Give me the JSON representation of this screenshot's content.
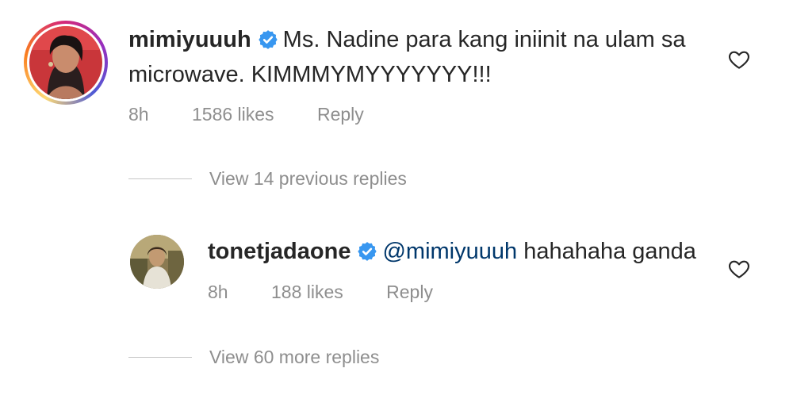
{
  "comment": {
    "username": "mimiyuuuh",
    "text_line1": "Ms. Nadine para kang iniinit na ulam sa",
    "text_line2": "microwave. KIMMMYMYYYYYYY!!!",
    "time": "8h",
    "likes": "1586 likes",
    "reply_label": "Reply",
    "avatar_icon": "profile-photo-woman",
    "like_icon": "heart-outline-icon"
  },
  "previous_replies": {
    "label": "View 14 previous replies"
  },
  "reply": {
    "username": "tonetjadaone",
    "mention": "@mimiyuuuh",
    "text": "hahahaha ganda",
    "time": "8h",
    "likes": "188 likes",
    "reply_label": "Reply",
    "avatar_icon": "profile-photo-person",
    "like_icon": "heart-outline-icon"
  },
  "more_replies": {
    "label": "View 60 more replies"
  },
  "colors": {
    "text": "#262626",
    "muted": "#8e8e8e",
    "mention": "#00376b",
    "verified": "#3897f0"
  }
}
